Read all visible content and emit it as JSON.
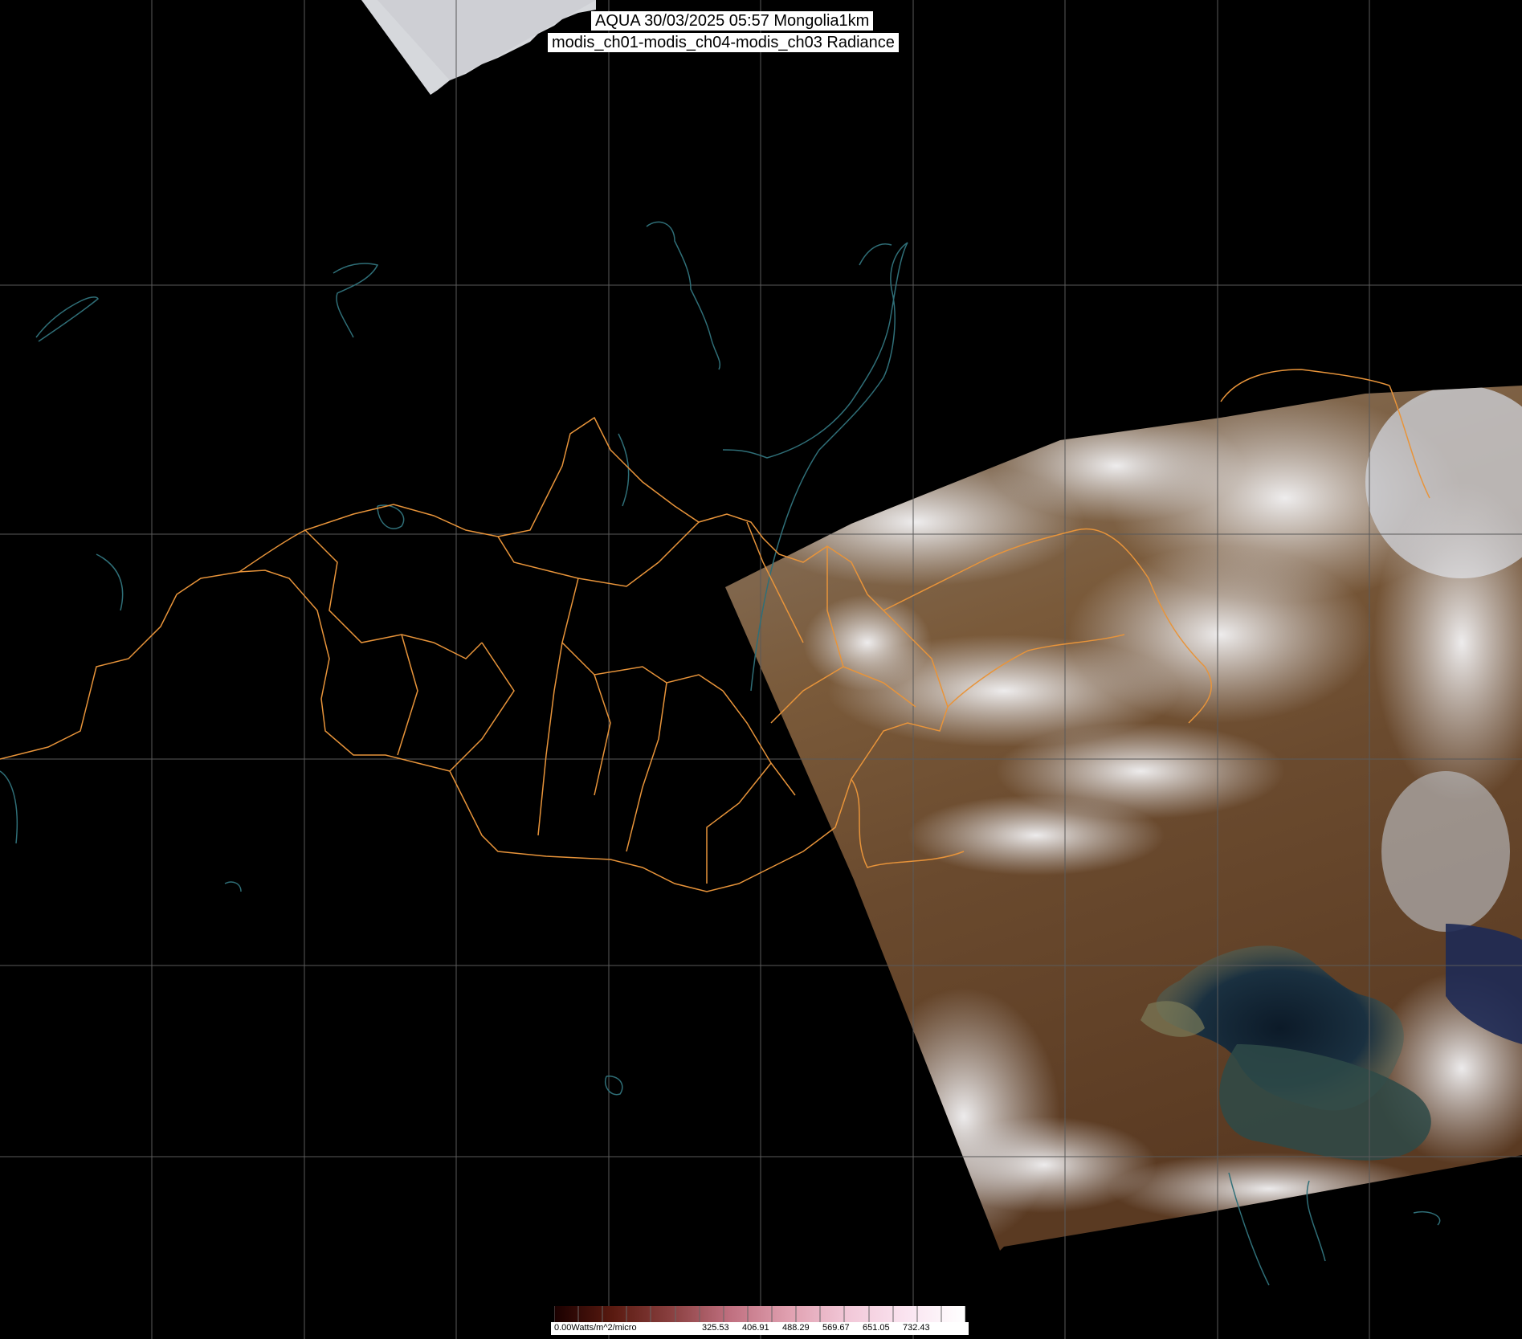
{
  "header": {
    "title_line1": "AQUA 30/03/2025 05:57 Mongolia1km",
    "title_line2": "modis_ch01-modis_ch04-modis_ch03 Radiance"
  },
  "legend": {
    "min_label": "0.00Watts/m^2/micro",
    "tick_labels": [
      "325.53",
      "406.91",
      "488.29",
      "569.67",
      "651.05",
      "732.43"
    ],
    "gradient_colors": [
      "#1a0000",
      "#5a1a10",
      "#8a4040",
      "#c07080",
      "#e0a0b0",
      "#f2c8d8",
      "#fae4f0",
      "#ffffff"
    ]
  },
  "colors": {
    "background": "#000000",
    "grid": "#5a5a5a",
    "border": "#e8943a",
    "coastline": "#2f6f78"
  },
  "icons": {
    "satellite-swath": "satellite-swath-image",
    "upper-swath": "satellite-swath-image"
  }
}
